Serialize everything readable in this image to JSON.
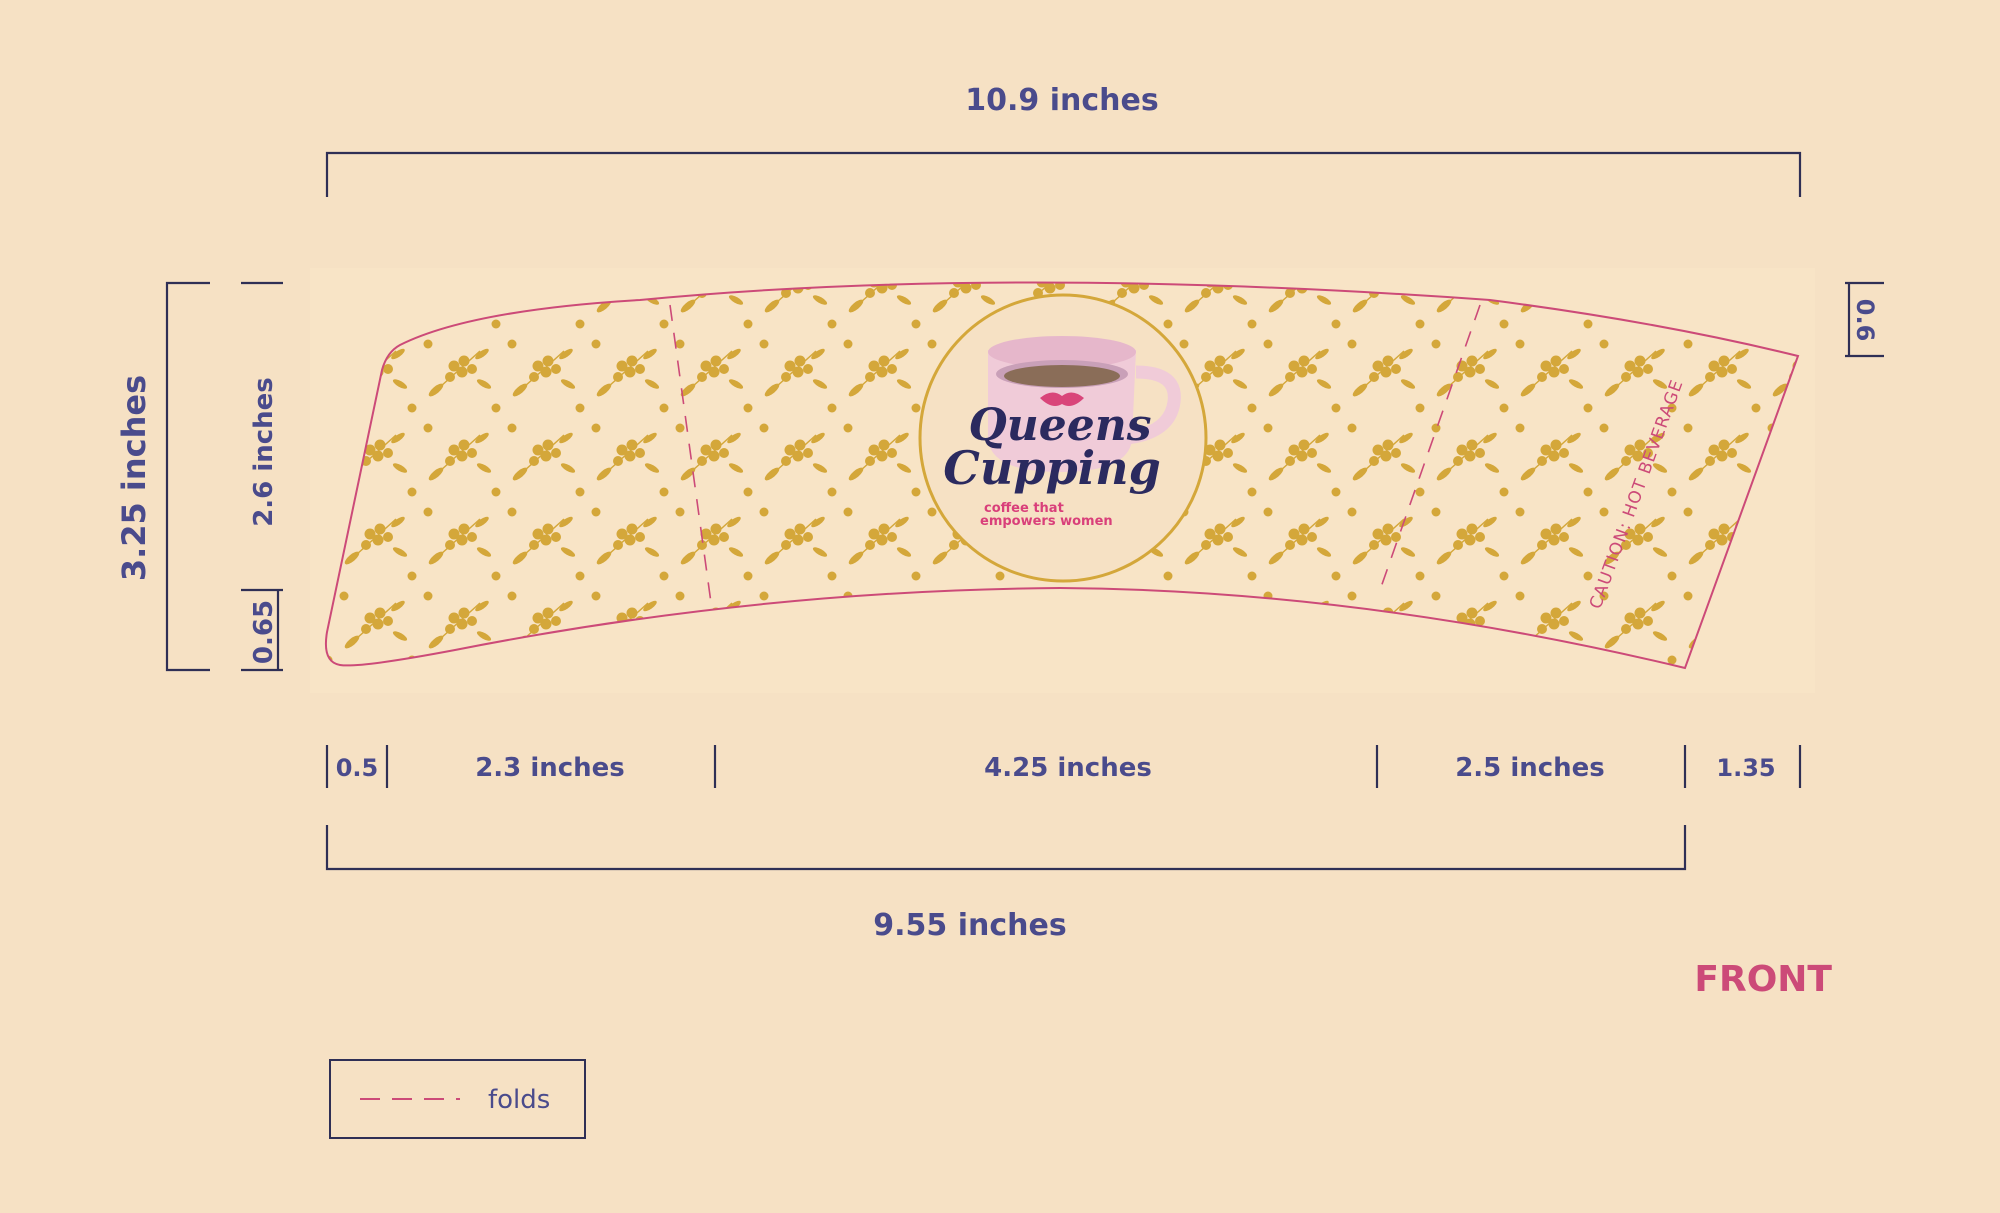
{
  "dimensions": {
    "top_width": "10.9 inches",
    "bottom_width": "9.55 inches",
    "height_total": "3.25 inches",
    "height_band": "2.6 inches",
    "height_bottom": "0.65",
    "height_right": "0.6",
    "seg_1": "0.5",
    "seg_2": "2.3 inches",
    "seg_3": "4.25 inches",
    "seg_4": "2.5 inches",
    "seg_5": "1.35"
  },
  "logo": {
    "line1": "Queens",
    "line2": "Cupping",
    "tagline1": "coffee that",
    "tagline2": "empowers women"
  },
  "caution": "CAUTION: HOT BEVERAGE",
  "side_label": "FRONT",
  "legend": {
    "label": "folds"
  },
  "colors": {
    "background": "#f6e1c4",
    "dimension_text": "#4a4b8c",
    "accent_pink": "#cc4a78",
    "pattern_gold": "#d4a73a"
  }
}
